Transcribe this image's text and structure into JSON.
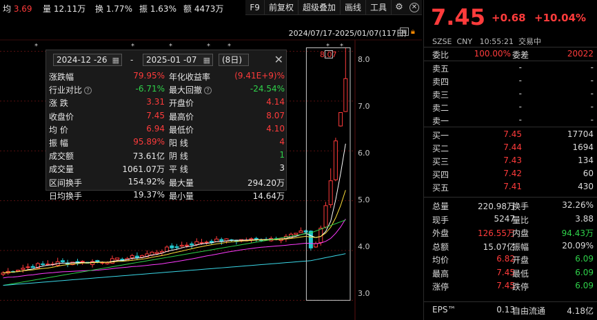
{
  "top_bar": {
    "avg_label": "均",
    "avg_value": "3.69",
    "vol_label": "量",
    "vol_value": "12.11万",
    "turn_label": "换",
    "turn_value": "1.77%",
    "amp_label": "振",
    "amp_value": "1.63%",
    "amt_label": "额",
    "amt_value": "4473万"
  },
  "toolbar": {
    "f9": "F9",
    "fuquan": "前复权",
    "overlay": "超级叠加",
    "draw": "画线",
    "tools": "工具",
    "settings_icon": "gear-icon",
    "close_icon": "close-icon"
  },
  "chart_header": {
    "range": "2024/07/17-2025/01/07(117日)"
  },
  "chart_data": {
    "type": "candlestick",
    "y_ticks": [
      "8.0",
      "7.0",
      "6.0",
      "5.0",
      "4.0",
      "3.0"
    ],
    "ylim": [
      2.95,
      8.2
    ],
    "selection_marker": "8.07",
    "colors": {
      "up": "#ff3b3b",
      "down": "#23c7ce",
      "ma5": "#ffffff",
      "ma10": "#ffe23b",
      "ma20": "#ff3bff",
      "ma60": "#2fd24a",
      "ma120": "#3ad8e8"
    }
  },
  "popup": {
    "start_date": "2024-12 -26",
    "end_date": "2025-01 -07",
    "dash": "-",
    "days": "(8日)",
    "rows": [
      {
        "l": "涨跌幅",
        "lv": "79.95%",
        "lc": "red",
        "r": "年化收益率",
        "rv": "(9.41E+9)%",
        "rc": "red"
      },
      {
        "l": "行业对比",
        "lq": true,
        "lv": "-6.71%",
        "lc": "green",
        "r": "最大回撤",
        "rq": true,
        "rv": "-24.54%",
        "rc": "green"
      },
      {
        "l": "涨 跌",
        "lv": "3.31",
        "lc": "red",
        "r": "开盘价",
        "rv": "4.14",
        "rc": "red"
      },
      {
        "l": "收盘价",
        "lv": "7.45",
        "lc": "red",
        "r": "最高价",
        "rv": "8.07",
        "rc": "red"
      },
      {
        "l": "均 价",
        "lv": "6.94",
        "lc": "red",
        "r": "最低价",
        "rv": "4.10",
        "rc": "red"
      },
      {
        "l": "振 幅",
        "lv": "95.89%",
        "lc": "red",
        "r": "阳 线",
        "rv": "4",
        "rc": "red"
      },
      {
        "l": "成交额",
        "lv": "73.61亿",
        "lc": "",
        "r": "阴 线",
        "rv": "1",
        "rc": "green"
      },
      {
        "l": "成交量",
        "lv": "1061.07万",
        "lc": "",
        "r": "平 线",
        "rv": "3",
        "rc": ""
      },
      {
        "l": "区间换手",
        "lv": "154.92%",
        "lc": "",
        "r": "最大量",
        "rv": "294.20万",
        "rc": ""
      },
      {
        "l": "日均换手",
        "lv": "19.37%",
        "lc": "",
        "r": "最小量",
        "rv": "14.64万",
        "rc": ""
      }
    ]
  },
  "quote": {
    "price": "7.45",
    "change": "+0.68",
    "change_pct": "+10.04%",
    "market": "SZSE",
    "currency": "CNY",
    "time": "10:55:21",
    "status": "交易中",
    "weibi_label": "委比",
    "weibi_value": "100.00%",
    "weicha_label": "委差",
    "weicha_value": "20022",
    "sells": [
      {
        "label": "卖五",
        "price": "-",
        "vol": "-"
      },
      {
        "label": "卖四",
        "price": "-",
        "vol": "-"
      },
      {
        "label": "卖三",
        "price": "-",
        "vol": "-"
      },
      {
        "label": "卖二",
        "price": "-",
        "vol": "-"
      },
      {
        "label": "卖一",
        "price": "-",
        "vol": "-"
      }
    ],
    "buys": [
      {
        "label": "买一",
        "price": "7.45",
        "vol": "17704"
      },
      {
        "label": "买二",
        "price": "7.44",
        "vol": "1694"
      },
      {
        "label": "买三",
        "price": "7.43",
        "vol": "134"
      },
      {
        "label": "买四",
        "price": "7.42",
        "vol": "60"
      },
      {
        "label": "买五",
        "price": "7.41",
        "vol": "430"
      }
    ],
    "stats": [
      {
        "a": "总量",
        "b": "220.98万",
        "bc": "",
        "c": "换手",
        "d": "32.26%",
        "dc": ""
      },
      {
        "a": "现手",
        "b": "5247",
        "bc": "",
        "c": "量比",
        "d": "3.88",
        "dc": ""
      },
      {
        "a": "外盘",
        "b": "126.55万",
        "bc": "red",
        "c": "内盘",
        "d": "94.43万",
        "dc": "green"
      },
      {
        "a": "总额",
        "b": "15.07亿",
        "bc": "",
        "c": "振幅",
        "d": "20.09%",
        "dc": ""
      },
      {
        "a": "均价",
        "b": "6.82",
        "bc": "red",
        "c": "开盘",
        "d": "6.09",
        "dc": "green"
      },
      {
        "a": "最高",
        "b": "7.45",
        "bc": "red",
        "c": "最低",
        "d": "6.09",
        "dc": "green"
      },
      {
        "a": "涨停",
        "b": "7.45",
        "bc": "red",
        "c": "跌停",
        "d": "6.09",
        "dc": "green"
      },
      {
        "a": "EPS™",
        "b": "0.13",
        "bc": "",
        "c": "自由流通",
        "d": "4.18亿",
        "dc": ""
      }
    ]
  }
}
